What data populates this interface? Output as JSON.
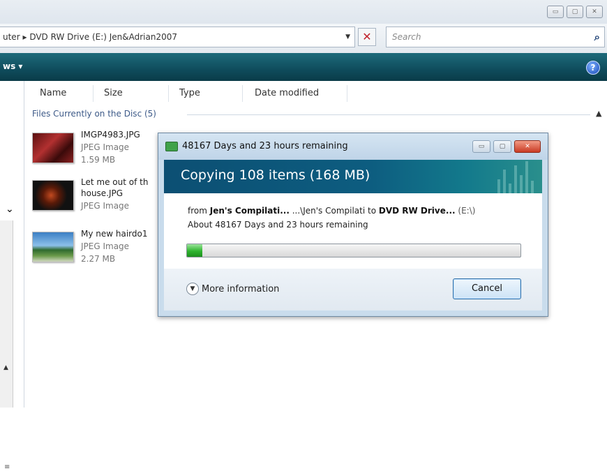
{
  "window": {
    "controls": [
      "minimize",
      "maximize",
      "close"
    ]
  },
  "address": {
    "path_fragment": "uter",
    "breadcrumb": "DVD RW Drive (E:) Jen&Adrian2007"
  },
  "search": {
    "placeholder": "Search"
  },
  "toolbar": {
    "views_label": "ws",
    "help_label": "?"
  },
  "columns": [
    "Name",
    "Size",
    "Type",
    "Date modified"
  ],
  "group": {
    "label": "Files Currently on the Disc (5)"
  },
  "files": [
    {
      "name": "IMGP4983.JPG",
      "type": "JPEG Image",
      "size": "1.59 MB"
    },
    {
      "name": "Let me out of th",
      "name2": "house.JPG",
      "type": "JPEG Image"
    },
    {
      "name": "My new hairdo1",
      "type": "JPEG Image",
      "size": "2.27 MB"
    }
  ],
  "dialog": {
    "title": "48167 Days and 23 hours remaining",
    "heading": "Copying 108 items (168 MB)",
    "from_prefix": "from",
    "from_source": "Jen's Compilati...",
    "from_path": "...\\Jen's Compilati to",
    "dest": "DVD RW Drive...",
    "dest_drive": "(E:\\)",
    "about": "About 48167 Days and 23 hours remaining",
    "progress_fraction": 0.045,
    "more_info": "More information",
    "cancel": "Cancel"
  },
  "colors": {
    "toolbar": "#0f4c5c",
    "banner": "#0d5d80",
    "progress": "#2fb42f"
  }
}
